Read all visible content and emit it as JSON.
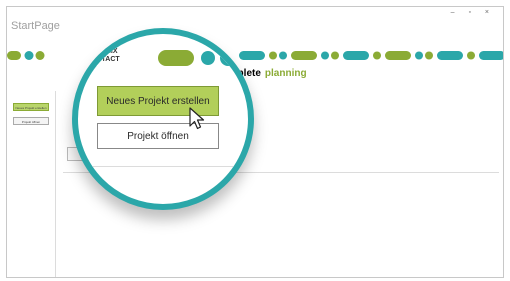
{
  "window": {
    "title": "StartPage",
    "controls": "– ▫ ×"
  },
  "subtitle": {
    "complete": "complete",
    "planning": "planning"
  },
  "brand": {
    "logo_line1": "PHOENIX",
    "logo_line2": "CONTACT"
  },
  "colors": {
    "accent_green": "#b2cf5a",
    "dark_green": "#8bab35",
    "magnifier_ring": "#2ba7a9",
    "banner_teal": "#2ba7a9"
  },
  "sidebar": {
    "items": [
      {
        "label": "Neues Projekt erstellen"
      },
      {
        "label": "Projekt öffnen"
      }
    ]
  },
  "main": {
    "new_project_button": "Neues Projekt erstellen",
    "open_project_button": "Projekt öffnen"
  },
  "icons": {
    "cursor": "mouse-pointer-icon",
    "logo": "phoenix-contact-logo"
  }
}
